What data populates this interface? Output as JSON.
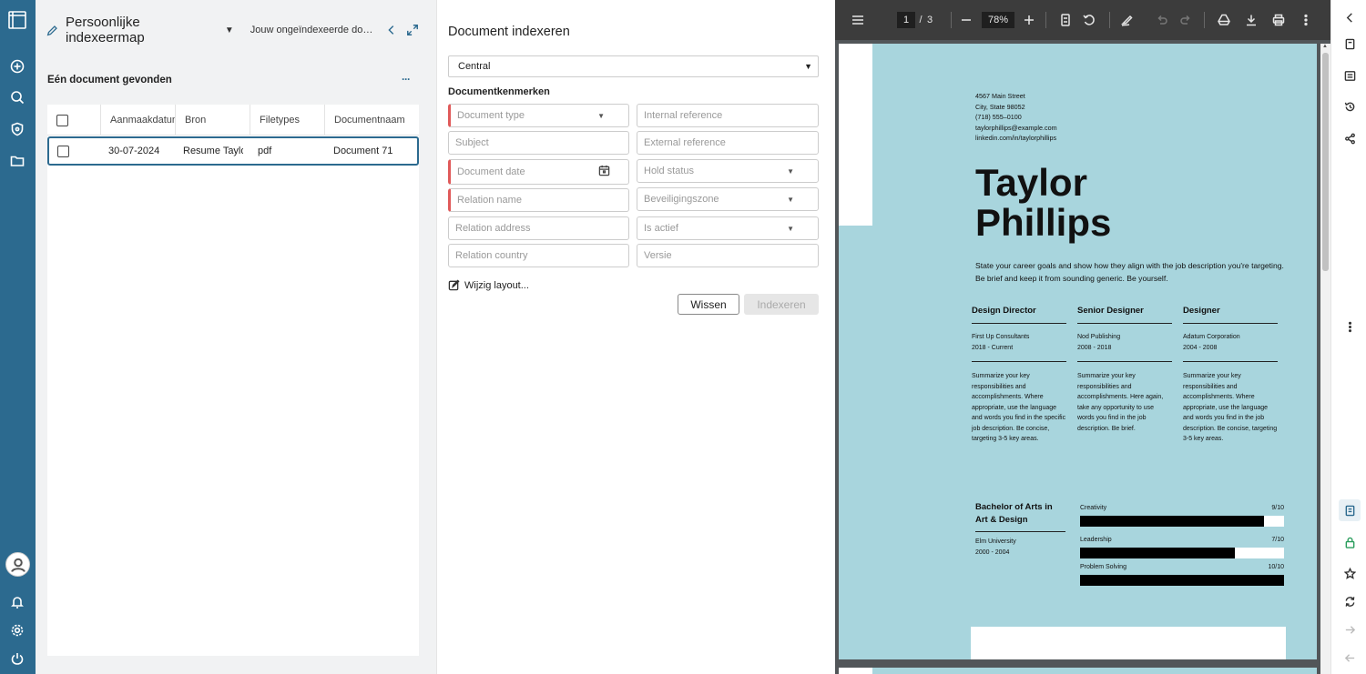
{
  "nav": {
    "icons": [
      "layout-icon",
      "plus-circle-icon",
      "search-icon",
      "shield-icon",
      "folder-icon",
      "avatar",
      "bell-icon",
      "gear-icon",
      "power-icon"
    ]
  },
  "left_panel": {
    "title": "Persoonlijke indexeermap",
    "subtitle": "Jouw ongeïndexeerde documenten",
    "result_count": "Eén document gevonden",
    "more": "···",
    "columns": [
      "Aanmaakdatum",
      "Bron",
      "Filetypes",
      "Documentnaam"
    ],
    "rows": [
      {
        "date": "30-07-2024",
        "source": "Resume Taylor Phillips",
        "filetype": "pdf",
        "name": "Document 71"
      }
    ]
  },
  "index_panel": {
    "title": "Document indexeren",
    "repository": "Central",
    "section_label": "Documentkenmerken",
    "fields": {
      "document_type": "Document type",
      "internal_reference": "Internal reference",
      "subject": "Subject",
      "external_reference": "External reference",
      "document_date": "Document date",
      "hold_status": "Hold status",
      "relation_name": "Relation name",
      "security_zone": "Beveiligingszone",
      "relation_address": "Relation address",
      "is_active": "Is actief",
      "relation_country": "Relation country",
      "version": "Versie"
    },
    "edit_layout": "Wijzig layout...",
    "clear_button": "Wissen",
    "index_button": "Indexeren"
  },
  "pdf_viewer": {
    "current_page": "1",
    "page_separator": "/",
    "total_pages": "3",
    "zoom": "78%",
    "resume": {
      "contact": [
        "4567 Main Street",
        "City, State 98052",
        "(718) 555–0100",
        "taylorphillips@example.com",
        "linkedin.com/in/taylorphillips"
      ],
      "first_name": "Taylor",
      "last_name": "Phillips",
      "summary": "State your career goals and show how they align with the job description you're targeting. Be brief and keep it from sounding generic. Be yourself.",
      "jobs": [
        {
          "title": "Design Director",
          "company": "First Up Consultants",
          "period": "2018 - Current",
          "desc": "Summarize your key responsibilities and accomplishments. Where appropriate, use the language and words you find in the specific job description. Be concise, targeting 3-5 key areas."
        },
        {
          "title": "Senior Designer",
          "company": "Nod Publishing",
          "period": "2008 - 2018",
          "desc": "Summarize your key responsibilities and accomplishments. Here again, take any opportunity to use words you find in the job description. Be brief."
        },
        {
          "title": "Designer",
          "company": "Adatum Corporation",
          "period": "2004 - 2008",
          "desc": "Summarize your key responsibilities and accomplishments. Where appropriate, use the language and words you find in the job description. Be concise, targeting 3-5 key areas."
        }
      ],
      "education": {
        "degree": "Bachelor of Arts in Art & Design",
        "school": "Elm University",
        "period": "2000 - 2004"
      },
      "skills": [
        {
          "name": "Creativity",
          "score": "9/10",
          "level": 0.9
        },
        {
          "name": "Leadership",
          "score": "7/10",
          "level": 0.76
        },
        {
          "name": "Problem Solving",
          "score": "10/10",
          "level": 1.0
        }
      ]
    }
  },
  "colors": {
    "nav": "#2c6a8f",
    "required": "#e05a5a",
    "pdf_page": "#a8d5dd"
  }
}
